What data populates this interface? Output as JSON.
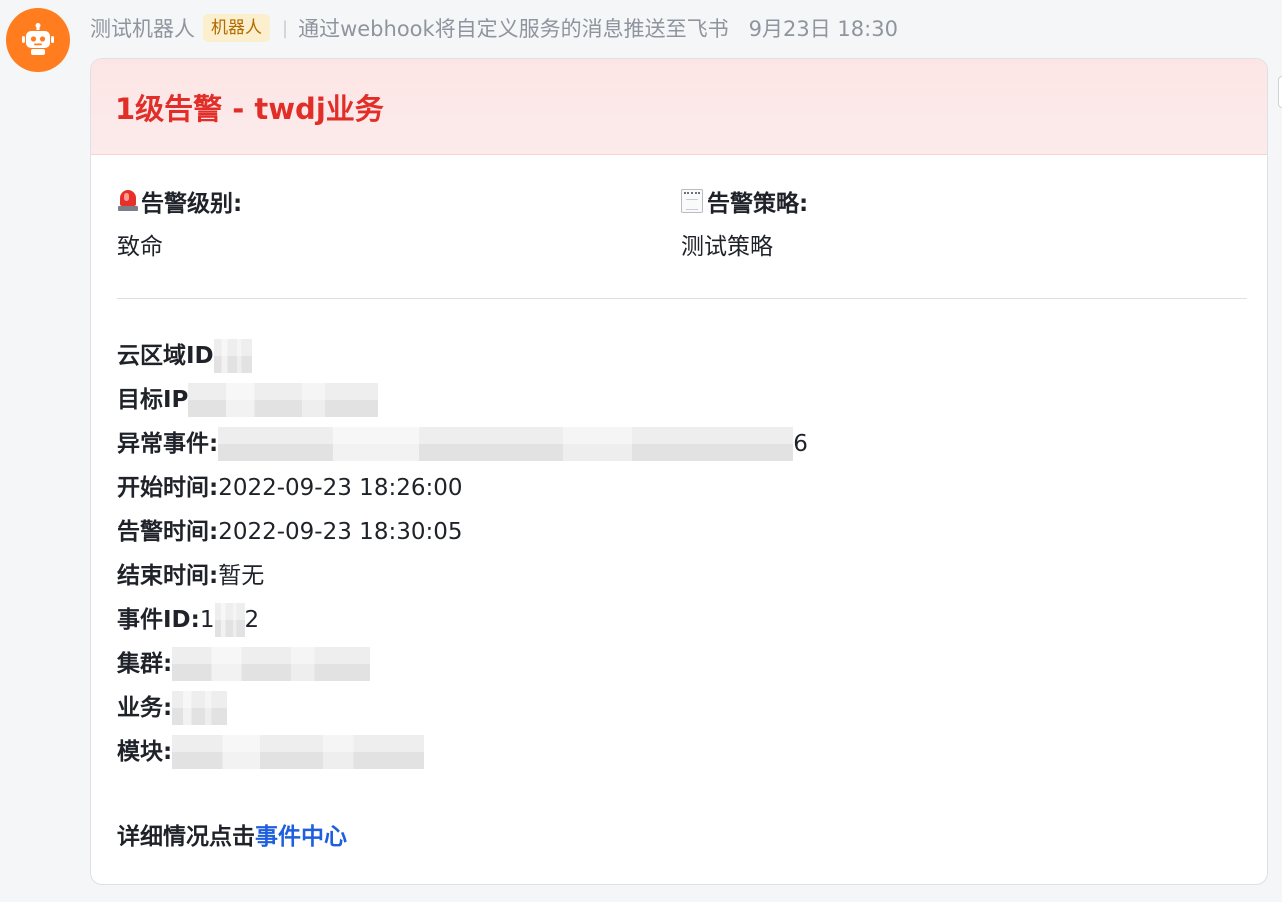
{
  "message": {
    "sender_name": "测试机器人",
    "bot_badge": "机器人",
    "separator": "|",
    "description": "通过webhook将自定义服务的消息推送至飞书",
    "time": "9月23日 18:30"
  },
  "card": {
    "header_title": "1级告警 - twdj业务",
    "header_color": "#e22e28",
    "alert_level": {
      "label": "告警级别:",
      "value": "致命",
      "icon": "siren-icon"
    },
    "alert_policy": {
      "label": "告警策略:",
      "value": "测试策略",
      "icon": "memo-icon"
    },
    "details": [
      {
        "label": "云区域ID",
        "value": ""
      },
      {
        "label": "目标IP",
        "value": ""
      },
      {
        "label": "异常事件:",
        "value": "6"
      },
      {
        "label": "开始时间:",
        "value": "2022-09-23 18:26:00"
      },
      {
        "label": "告警时间:",
        "value": "2022-09-23 18:30:05"
      },
      {
        "label": "结束时间:",
        "value": "暂无"
      },
      {
        "label": "事件ID:",
        "value": "1",
        "suffix": "2"
      },
      {
        "label": "集群:",
        "value": ""
      },
      {
        "label": "业务:",
        "value": ""
      },
      {
        "label": "模块:",
        "value": ""
      }
    ],
    "footer_text": "详细情况点击",
    "footer_link": "事件中心",
    "link_color": "#1f5fde"
  }
}
